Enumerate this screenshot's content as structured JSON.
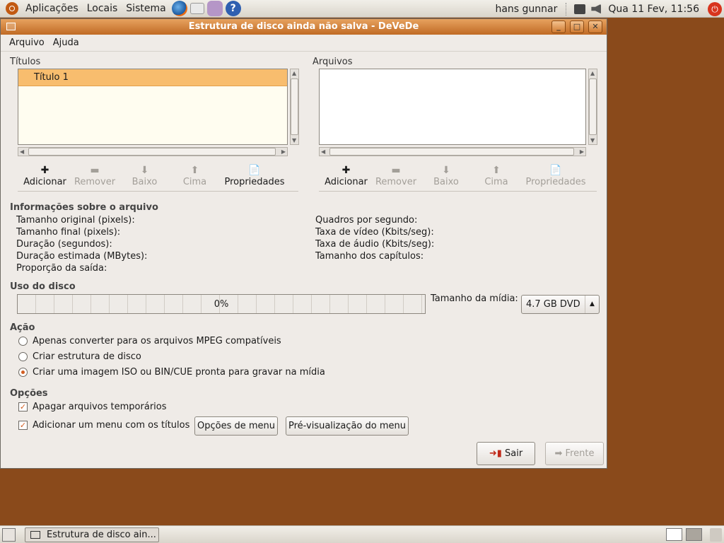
{
  "top_panel": {
    "menus": [
      "Aplicações",
      "Locais",
      "Sistema"
    ],
    "user": "hans gunnar",
    "clock": "Qua 11 Fev, 11:56"
  },
  "window": {
    "title": "Estrutura de disco ainda não salva - DeVeDe",
    "menubar": [
      "Arquivo",
      "Ajuda"
    ]
  },
  "titles": {
    "label": "Títulos",
    "items": [
      "Título 1"
    ],
    "toolbar": [
      "Adicionar",
      "Remover",
      "Baixo",
      "Cima",
      "Propriedades"
    ]
  },
  "files": {
    "label": "Arquivos",
    "toolbar": [
      "Adicionar",
      "Remover",
      "Baixo",
      "Cima",
      "Propriedades"
    ]
  },
  "file_info": {
    "heading": "Informações sobre o arquivo",
    "left": [
      "Tamanho original (pixels):",
      "Tamanho final (pixels):",
      "Duração (segundos):",
      "Duração estimada (MBytes):",
      "Proporção da saída:"
    ],
    "right": [
      "Quadros por segundo:",
      "Taxa de vídeo (Kbits/seg):",
      "Taxa de áudio (Kbits/seg):",
      "Tamanho dos capítulos:"
    ]
  },
  "disk": {
    "heading": "Uso do disco",
    "progress_text": "0%",
    "progress_value": 0,
    "media_label": "Tamanho da mídia:",
    "media_value": "4.7 GB DVD"
  },
  "action": {
    "heading": "Ação",
    "options": [
      "Apenas converter para os arquivos MPEG compatíveis",
      "Criar estrutura de disco",
      "Criar uma imagem ISO ou BIN/CUE pronta para gravar na mídia"
    ],
    "selected_index": 2
  },
  "options": {
    "heading": "Opções",
    "delete_temp": "Apagar arquivos temporários",
    "add_menu": "Adicionar um menu com os títulos",
    "menu_options_btn": "Opções de menu",
    "menu_preview_btn": "Pré-visualização do menu"
  },
  "buttons": {
    "quit": "Sair",
    "forward": "Frente"
  },
  "taskbar": {
    "task": "Estrutura de disco ain..."
  },
  "colors": {
    "desktop": "#8a4a1b",
    "titlebar": "#d98234",
    "selection": "#f8bd6e"
  }
}
